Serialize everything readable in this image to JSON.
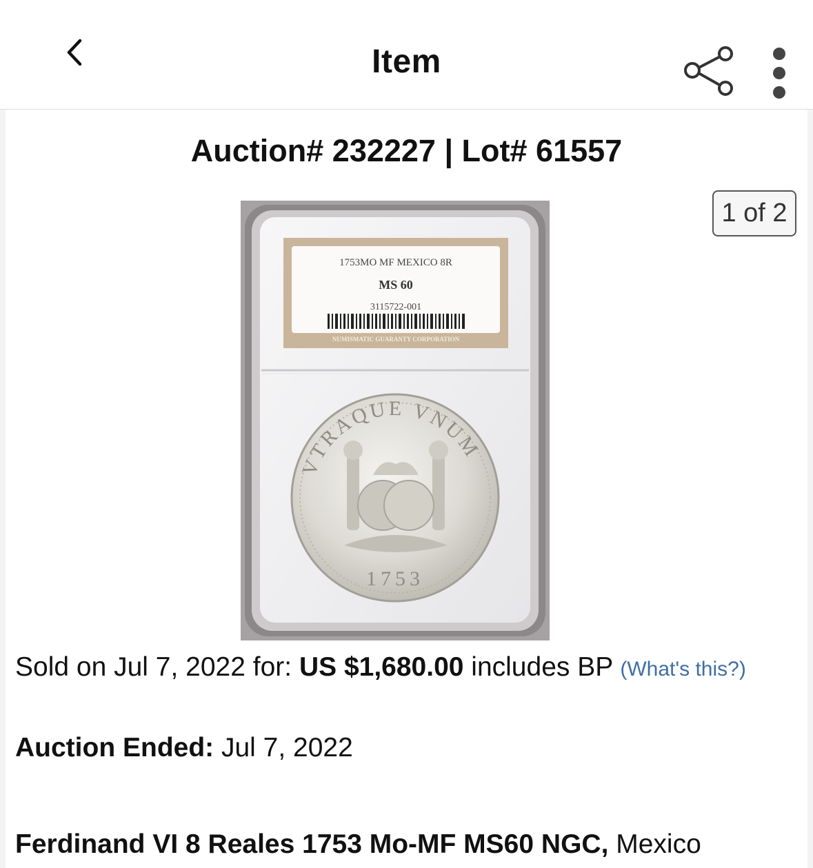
{
  "nav": {
    "title": "Item",
    "back_icon": "chevron-left-icon",
    "share_icon": "share-icon",
    "more_icon": "vertical-ellipsis-icon"
  },
  "auction": {
    "header": "Auction# 232227 | Lot# 61557",
    "image_counter": "1 of 2"
  },
  "coin_image": {
    "label_line1": "1753MO MF MEXICO 8R",
    "label_grade": "MS 60",
    "label_cert": "3115722-001",
    "label_footer": "NUMISMATIC GUARANTY CORPORATION",
    "coin_legend_top": "VTRAQUE VNUM",
    "coin_year": "1753"
  },
  "sale": {
    "sold_prefix": "Sold on Jul 7, 2022 for: ",
    "price": "US $1,680.00",
    "sold_suffix": " includes BP ",
    "whats_this": "(What's this?)"
  },
  "ended": {
    "label": "Auction Ended:",
    "date": " Jul 7, 2022"
  },
  "lot": {
    "title_bold": "Ferdinand VI 8 Reales 1753 Mo-MF MS60 NGC,",
    "title_rest": " Mexico"
  },
  "colors": {
    "link": "#3e6fa3",
    "label_tan": "#c8b49a",
    "slab_border": "#8e8a8c",
    "coin_silver": "#dedcd6"
  }
}
